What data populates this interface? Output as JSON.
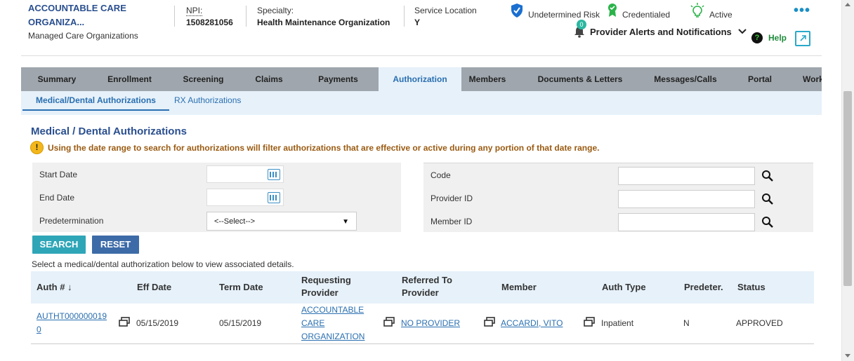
{
  "header": {
    "org_name": "ACCOUNTABLE CARE ORGANIZA...",
    "org_type": "Managed Care Organizations",
    "npi_label": "NPI:",
    "npi_value": "1508281056",
    "specialty_label": "Specialty:",
    "specialty_value": "Health Maintenance Organization",
    "service_location_label": "Service Location",
    "service_location_value": "Y",
    "badges": [
      {
        "label": "Undetermined Risk",
        "icon": "shield-check-icon",
        "color": "#1a6fd0"
      },
      {
        "label": "Credentialed",
        "icon": "ribbon-award-icon",
        "color": "#2bb34a"
      },
      {
        "label": "Active",
        "icon": "lightbulb-icon",
        "color": "#2bb34a"
      }
    ],
    "more_icon": "ellipsis-icon",
    "alerts_label": "Provider Alerts and Notifications",
    "alerts_count": "0",
    "help_label": "Help"
  },
  "tabs": [
    {
      "label": "Summary",
      "active": false
    },
    {
      "label": "Enrollment",
      "active": false
    },
    {
      "label": "Screening",
      "active": false
    },
    {
      "label": "Claims",
      "active": false
    },
    {
      "label": "Payments",
      "active": false
    },
    {
      "label": "Authorization",
      "active": true
    },
    {
      "label": "Members",
      "active": false
    },
    {
      "label": "Documents & Letters",
      "active": false
    },
    {
      "label": "Messages/Calls",
      "active": false
    },
    {
      "label": "Portal",
      "active": false
    },
    {
      "label": "Work",
      "active": false
    }
  ],
  "subtabs": [
    {
      "label": "Medical/Dental Authorizations",
      "active": true
    },
    {
      "label": "RX Authorizations",
      "active": false
    }
  ],
  "section_title": "Medical / Dental Authorizations",
  "notice": "Using the date range to search for authorizations will filter authorizations that are effective or active during any portion of that date range.",
  "form": {
    "start_date_label": "Start Date",
    "end_date_label": "End Date",
    "predetermination_label": "Predetermination",
    "predetermination_value": "<--Select-->",
    "code_label": "Code",
    "provider_id_label": "Provider ID",
    "member_id_label": "Member ID",
    "start_date_value": "",
    "end_date_value": "",
    "code_value": "",
    "provider_id_value": "",
    "member_id_value": ""
  },
  "buttons": {
    "search": "SEARCH",
    "reset": "RESET"
  },
  "hint": "Select a medical/dental authorization below to view associated details.",
  "table": {
    "headers": {
      "auth": "Auth # ↓",
      "eff_date": "Eff Date",
      "term_date": "Term Date",
      "requesting_provider_1": "Requesting",
      "requesting_provider_2": "Provider",
      "referred_to_1": "Referred To",
      "referred_to_2": "Provider",
      "member": "Member",
      "auth_type": "Auth Type",
      "predeter": "Predeter.",
      "status": "Status"
    },
    "rows": [
      {
        "auth_1": "AUTHT000000019",
        "auth_2": "0",
        "eff_date": "05/15/2019",
        "term_date": "05/15/2019",
        "requesting_1": "ACCOUNTABLE",
        "requesting_2": "CARE",
        "requesting_3": "ORGANIZATION",
        "referred_to": "NO PROVIDER",
        "member": "ACCARDI, VITO",
        "auth_type": "Inpatient",
        "predeter": "N",
        "status": "APPROVED"
      }
    ]
  }
}
